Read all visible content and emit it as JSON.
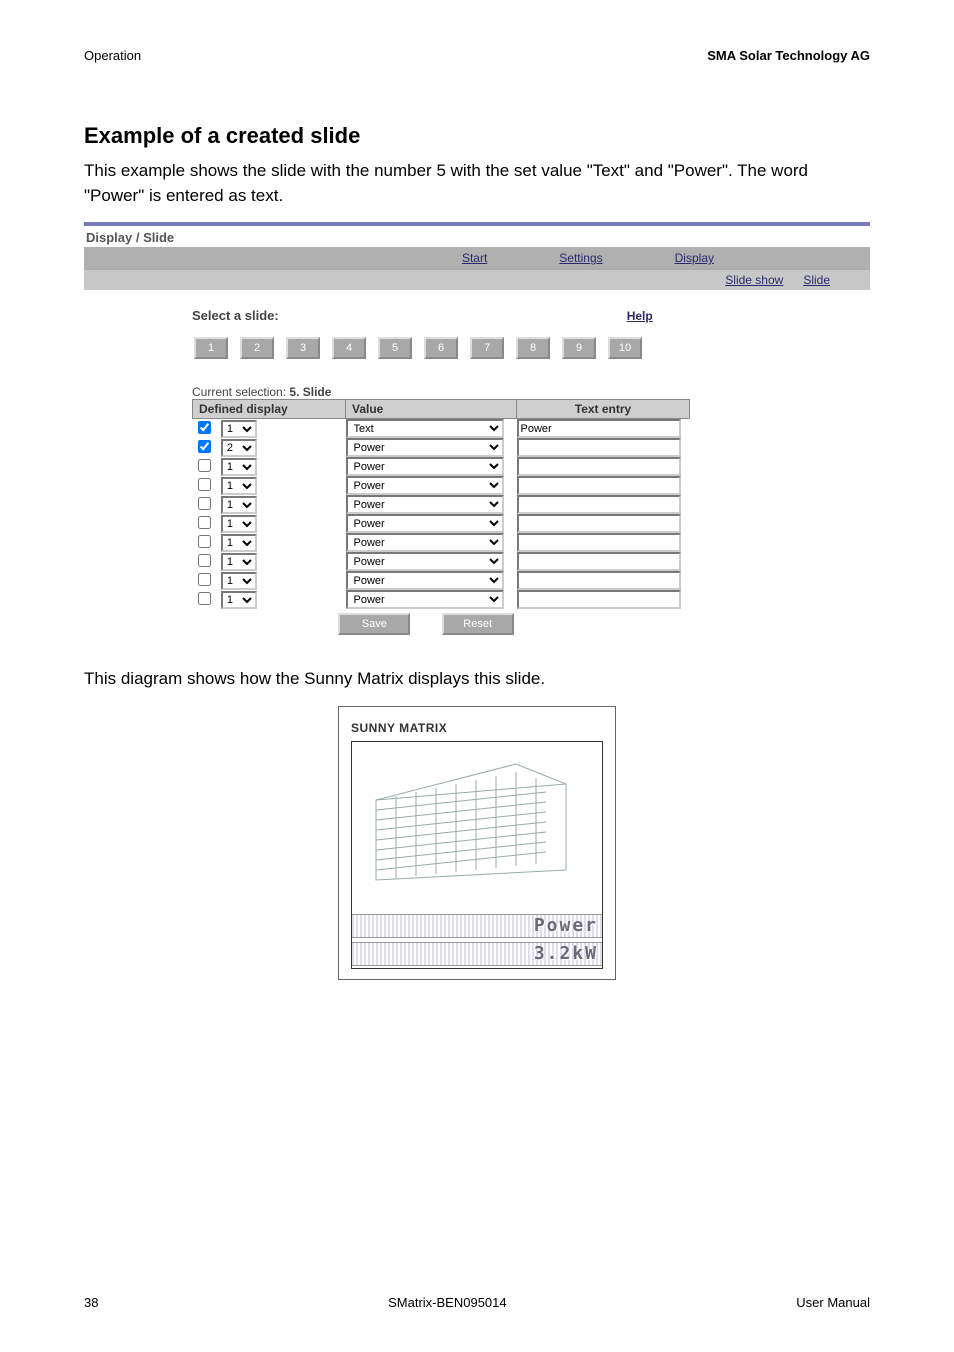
{
  "header": {
    "left": "Operation",
    "right": "SMA Solar Technology AG"
  },
  "section_title": "Example of a created slide",
  "intro_text": "This example shows the slide with the number 5 with the set value \"Text\" and \"Power\". The word \"Power\" is entered as text.",
  "app": {
    "breadcrumb": "Display / Slide",
    "nav": {
      "start": "Start",
      "settings": "Settings",
      "display": "Display"
    },
    "subnav": {
      "slide_show": "Slide show",
      "slide": "Slide"
    },
    "select_label": "Select a slide:",
    "help_label": "Help",
    "slide_numbers": [
      "1",
      "2",
      "3",
      "4",
      "5",
      "6",
      "7",
      "8",
      "9",
      "10"
    ],
    "current_selection_prefix": "Current selection: ",
    "current_selection_value": "5. Slide",
    "columns": {
      "defined_display": "Defined display",
      "value": "Value",
      "text_entry": "Text entry"
    },
    "rows": [
      {
        "checked": true,
        "display_num": "1",
        "value": "Text",
        "text": "Power"
      },
      {
        "checked": true,
        "display_num": "2",
        "value": "Power",
        "text": ""
      },
      {
        "checked": false,
        "display_num": "1",
        "value": "Power",
        "text": ""
      },
      {
        "checked": false,
        "display_num": "1",
        "value": "Power",
        "text": ""
      },
      {
        "checked": false,
        "display_num": "1",
        "value": "Power",
        "text": ""
      },
      {
        "checked": false,
        "display_num": "1",
        "value": "Power",
        "text": ""
      },
      {
        "checked": false,
        "display_num": "1",
        "value": "Power",
        "text": ""
      },
      {
        "checked": false,
        "display_num": "1",
        "value": "Power",
        "text": ""
      },
      {
        "checked": false,
        "display_num": "1",
        "value": "Power",
        "text": ""
      },
      {
        "checked": false,
        "display_num": "1",
        "value": "Power",
        "text": ""
      }
    ],
    "buttons": {
      "save": "Save",
      "reset": "Reset"
    }
  },
  "caption_text": "This diagram shows how the Sunny Matrix displays this slide.",
  "diagram": {
    "title": "SUNNY MATRIX",
    "line1": "Power",
    "line2": "3.2kW"
  },
  "footer": {
    "page": "38",
    "docid": "SMatrix-BEN095014",
    "manual": "User Manual"
  }
}
